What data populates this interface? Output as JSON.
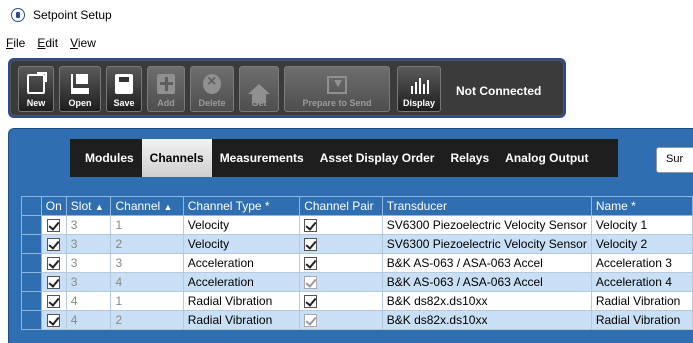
{
  "window": {
    "title": "Setpoint Setup"
  },
  "menu": {
    "items": [
      {
        "accel": "F",
        "rest": "ile"
      },
      {
        "accel": "E",
        "rest": "dit"
      },
      {
        "accel": "V",
        "rest": "iew"
      }
    ]
  },
  "toolbar": {
    "new_label": "New",
    "open_label": "Open",
    "save_label": "Save",
    "add_label": "Add",
    "delete_label": "Delete",
    "get_label": "Get",
    "prepare_label": "Prepare to Send",
    "display_label": "Display",
    "status": "Not Connected"
  },
  "tabs": {
    "items": [
      "Modules",
      "Channels",
      "Measurements",
      "Asset Display Order",
      "Relays",
      "Analog Output"
    ],
    "active": "Channels",
    "summary_label": "Sur"
  },
  "grid": {
    "headers": {
      "on": "On",
      "slot": "Slot",
      "channel": "Channel",
      "channel_type": "Channel Type *",
      "channel_pair": "Channel Pair",
      "transducer": "Transducer",
      "name": "Name *"
    },
    "sort_arrow": "▲",
    "rows": [
      {
        "slot": "3",
        "channel": "1",
        "type": "Velocity",
        "transducer": "SV6300 Piezoelectric Velocity Sensor",
        "name": "Velocity 1",
        "pair_enabled": true
      },
      {
        "slot": "3",
        "channel": "2",
        "type": "Velocity",
        "transducer": "SV6300 Piezoelectric Velocity Sensor",
        "name": "Velocity 2",
        "pair_enabled": true
      },
      {
        "slot": "3",
        "channel": "3",
        "type": "Acceleration",
        "transducer": "B&K AS-063 / ASA-063 Accel",
        "name": "Acceleration 3",
        "pair_enabled": true
      },
      {
        "slot": "3",
        "channel": "4",
        "type": "Acceleration",
        "transducer": "B&K AS-063 / ASA-063 Accel",
        "name": "Acceleration 4",
        "pair_enabled": false
      },
      {
        "slot": "4",
        "channel": "1",
        "type": "Radial Vibration",
        "transducer": "B&K ds82x.ds10xx",
        "name": "Radial Vibration",
        "pair_enabled": true
      },
      {
        "slot": "4",
        "channel": "2",
        "type": "Radial Vibration",
        "transducer": "B&K ds82x.ds10xx",
        "name": "Radial Vibration",
        "pair_enabled": false
      }
    ]
  }
}
